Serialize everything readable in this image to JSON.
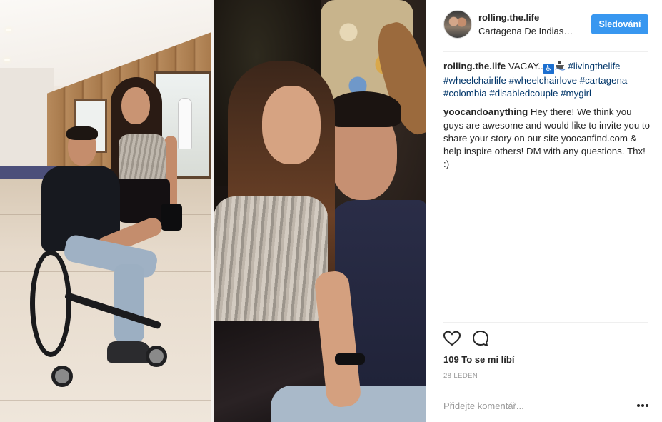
{
  "post": {
    "author": "rolling.the.life",
    "location": "Cartagena De Indias…",
    "follow_label": "Sledování"
  },
  "caption": {
    "user": "rolling.the.life",
    "text": "VACAY..",
    "hashtags": [
      "#livingthelife",
      "#wheelchairlife",
      "#wheelchairlove",
      "#cartagena",
      "#colombia",
      "#disabledcouple",
      "#mygirl"
    ],
    "emojis": [
      "wheelchair-symbol-icon",
      "passenger-ship-icon"
    ]
  },
  "comment": {
    "user": "yoocandoanything",
    "text": "Hey there! We think you guys are awesome and would like to invite you to share your story on our site yoocanfind.com & help inspire others! DM with any questions. Thx! :)"
  },
  "actions": {
    "like_icon": "heart-outline-icon",
    "comment_icon": "speech-bubble-icon",
    "likes_text": "109 To se mi líbí",
    "date": "28 LEDEN"
  },
  "add_comment": {
    "placeholder": "Přidejte komentář...",
    "more_icon": "ellipsis-icon"
  },
  "colors": {
    "follow_button": "#3897f0",
    "hashtag": "#003569",
    "text": "#262626",
    "muted": "#999999",
    "divider": "#efefef"
  }
}
